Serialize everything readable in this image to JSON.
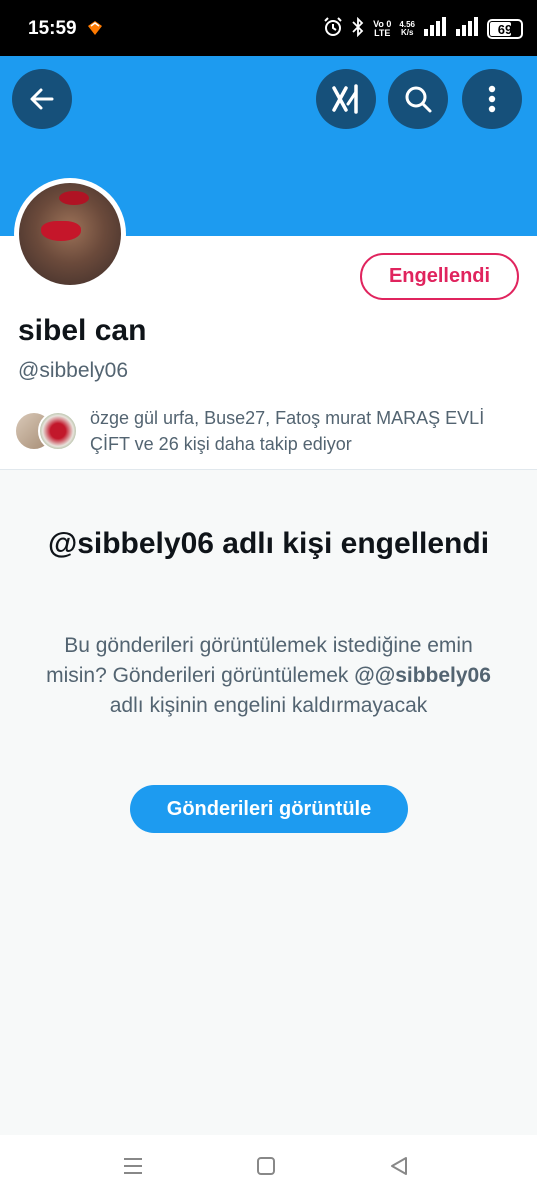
{
  "status_bar": {
    "time": "15:59",
    "lte_top": "Vo 0",
    "lte_bottom": "LTE",
    "speed_top": "4.56",
    "speed_bottom": "K/s",
    "battery": "69",
    "battery_level": 0.69
  },
  "header": {
    "back_icon": "arrow-left-icon",
    "grok_icon": "grok-icon",
    "search_icon": "search-icon",
    "more_icon": "more-vertical-icon"
  },
  "profile": {
    "display_name": "sibel can",
    "handle": "@sibbely06",
    "blocked_button": "Engellendi",
    "followed_by": "özge gül urfa, Buse27, Fatoş murat MARAŞ EVLİ ÇİFT ve 26 kişi daha takip ediyor"
  },
  "blocked": {
    "title": "@sibbely06 adlı kişi engellendi",
    "desc_part1": "Bu gönderileri görüntülemek istediğine emin misin? Gönderileri görüntülemek",
    "desc_handle": "@@sibbely06",
    "desc_part2": "adlı kişinin engelini kaldırmayacak",
    "view_button": "Gönderileri görüntüle"
  },
  "colors": {
    "accent": "#1d9bf0",
    "header_button": "#16507a",
    "blocked_red": "#e0245e",
    "text_primary": "#0f1419",
    "text_secondary": "#536471"
  },
  "nav": {
    "menu_icon": "menu-icon",
    "home_icon": "square-home-icon",
    "back_icon": "triangle-back-icon"
  }
}
